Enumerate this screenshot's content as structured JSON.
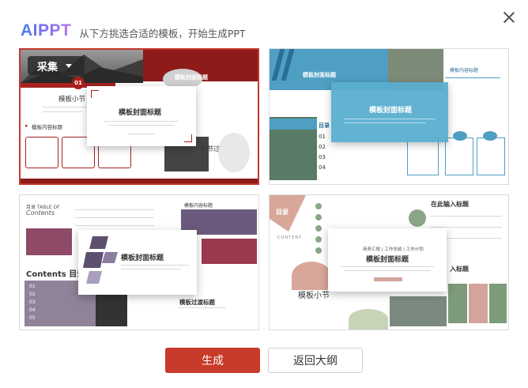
{
  "header": {
    "logo": "AIPPT",
    "subtitle": "从下方挑选合适的模板，开始生成PPT"
  },
  "templates": [
    {
      "collect_label": "采集",
      "cover_title": "模板封面标题",
      "section_label": "模板小节",
      "content_title": "模板内容标题",
      "transition_title": "小节过渡标题",
      "badge": "01"
    },
    {
      "cover_title": "模板封面标题",
      "content_title": "模板内容标题",
      "toc_label": "目录",
      "toc_numbers": [
        "01",
        "02",
        "03",
        "04"
      ]
    },
    {
      "toc_label": "目录 TABLE OF",
      "toc_italic": "Contents",
      "contents_label": "Contents 目录",
      "content_title": "模板内容标题",
      "cover_title": "模板封面标题",
      "transition_title": "模板过渡标题",
      "list_numbers": [
        "01",
        "02",
        "03",
        "04",
        "05"
      ]
    },
    {
      "toc_label": "目录",
      "content_en": "CONTENT",
      "cover_subtitle": "商务汇报 | 工作总结 | 工作计划",
      "cover_title": "模板封面标题",
      "input_title": "在此输入标题",
      "section_label": "模板小节",
      "side_title": "入标题"
    }
  ],
  "actions": {
    "generate": "生成",
    "back": "返回大纲"
  },
  "colors": {
    "accent": "#c83a29",
    "logo_start": "#4a7df0",
    "logo_end": "#b57ce8"
  }
}
